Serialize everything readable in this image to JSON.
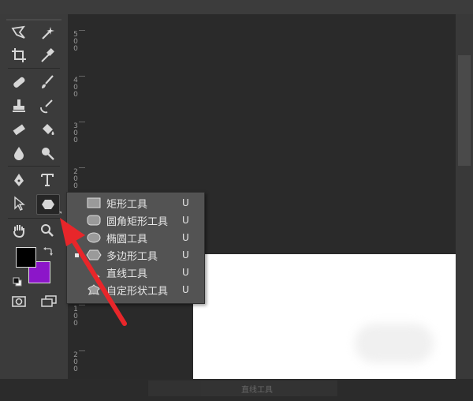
{
  "ruler": {
    "labels": [
      "500",
      "400",
      "300",
      "200",
      "100",
      "100",
      "200"
    ]
  },
  "shape_menu": {
    "items": [
      {
        "label": "矩形工具",
        "shortcut": "U",
        "icon": "rectangle-tool-icon"
      },
      {
        "label": "圆角矩形工具",
        "shortcut": "U",
        "icon": "rounded-rectangle-tool-icon"
      },
      {
        "label": "椭圆工具",
        "shortcut": "U",
        "icon": "ellipse-tool-icon"
      },
      {
        "label": "多边形工具",
        "shortcut": "U",
        "icon": "polygon-tool-icon",
        "selected": true
      },
      {
        "label": "直线工具",
        "shortcut": "U",
        "icon": "line-tool-icon"
      },
      {
        "label": "自定形状工具",
        "shortcut": "U",
        "icon": "custom-shape-tool-icon"
      }
    ]
  },
  "colors": {
    "foreground": "#000000",
    "background": "#8c16c9",
    "annotation_arrow": "#e8262a"
  },
  "status": {
    "blurred_text": "直线工具"
  }
}
